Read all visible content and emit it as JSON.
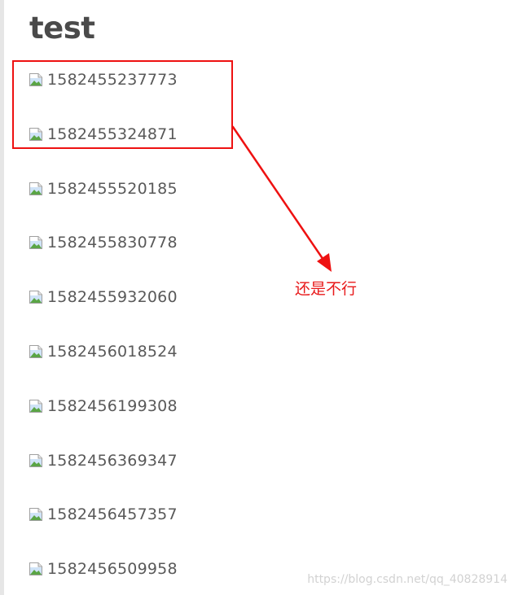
{
  "title": "test",
  "images": [
    {
      "alt": "1582455237773"
    },
    {
      "alt": "1582455324871"
    },
    {
      "alt": "1582455520185"
    },
    {
      "alt": "1582455830778"
    },
    {
      "alt": "1582455932060"
    },
    {
      "alt": "1582456018524"
    },
    {
      "alt": "1582456199308"
    },
    {
      "alt": "1582456369347"
    },
    {
      "alt": "1582456457357"
    },
    {
      "alt": "1582456509958"
    }
  ],
  "annotation": {
    "text": "还是不行",
    "color": "#e8191a"
  },
  "watermark": "https://blog.csdn.net/qq_40828914",
  "icons": {
    "broken_image": "broken-image-icon"
  }
}
